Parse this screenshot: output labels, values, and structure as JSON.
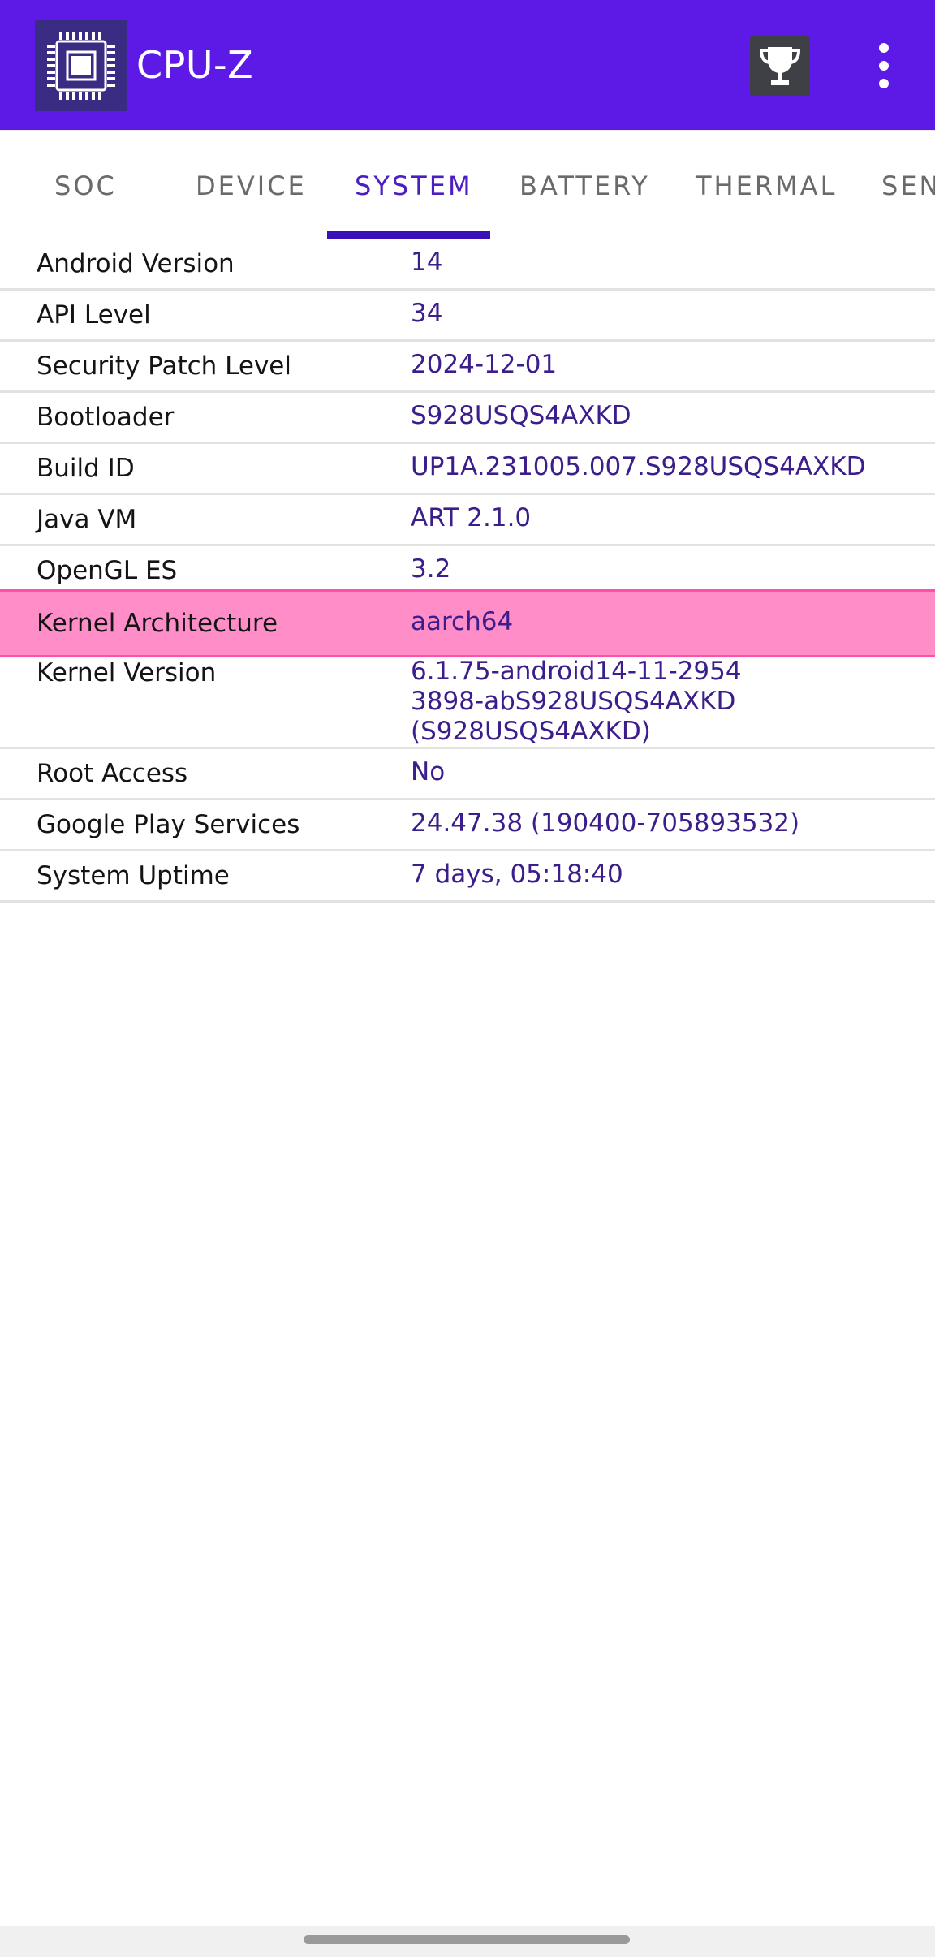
{
  "app": {
    "title": "CPU-Z",
    "logo_icon": "cpu-chip-icon",
    "trophy_icon": "trophy-icon",
    "menu_icon": "more-vertical-icon",
    "colors": {
      "appbar": "#5d1ae6",
      "active_tab": "#4b1ec2",
      "value_text": "#3c1d8c",
      "highlight": "#ff8ec8"
    }
  },
  "tabs": [
    {
      "label": "SOC",
      "active": false
    },
    {
      "label": "DEVICE",
      "active": false
    },
    {
      "label": "SYSTEM",
      "active": true
    },
    {
      "label": "BATTERY",
      "active": false
    },
    {
      "label": "THERMAL",
      "active": false
    },
    {
      "label": "SEN",
      "active": false
    }
  ],
  "rows": [
    {
      "label": "Android Version",
      "value": "14"
    },
    {
      "label": "API Level",
      "value": "34"
    },
    {
      "label": "Security Patch Level",
      "value": "2024-12-01"
    },
    {
      "label": "Bootloader",
      "value": "S928USQS4AXKD"
    },
    {
      "label": "Build ID",
      "value": "UP1A.231005.007.S928USQS4AXKD"
    },
    {
      "label": "Java VM",
      "value": "ART 2.1.0"
    },
    {
      "label": "OpenGL ES",
      "value": "3.2"
    },
    {
      "label": "Kernel Architecture",
      "value": "aarch64",
      "highlighted": true
    },
    {
      "label": "Kernel Version",
      "value": "6.1.75-android14-11-2954\n3898-abS928USQS4AXKD\n(S928USQS4AXKD)"
    },
    {
      "label": "Root Access",
      "value": "No"
    },
    {
      "label": "Google Play Services",
      "value": "24.47.38 (190400-705893532)"
    },
    {
      "label": "System Uptime",
      "value": "7 days, 05:18:40"
    }
  ]
}
